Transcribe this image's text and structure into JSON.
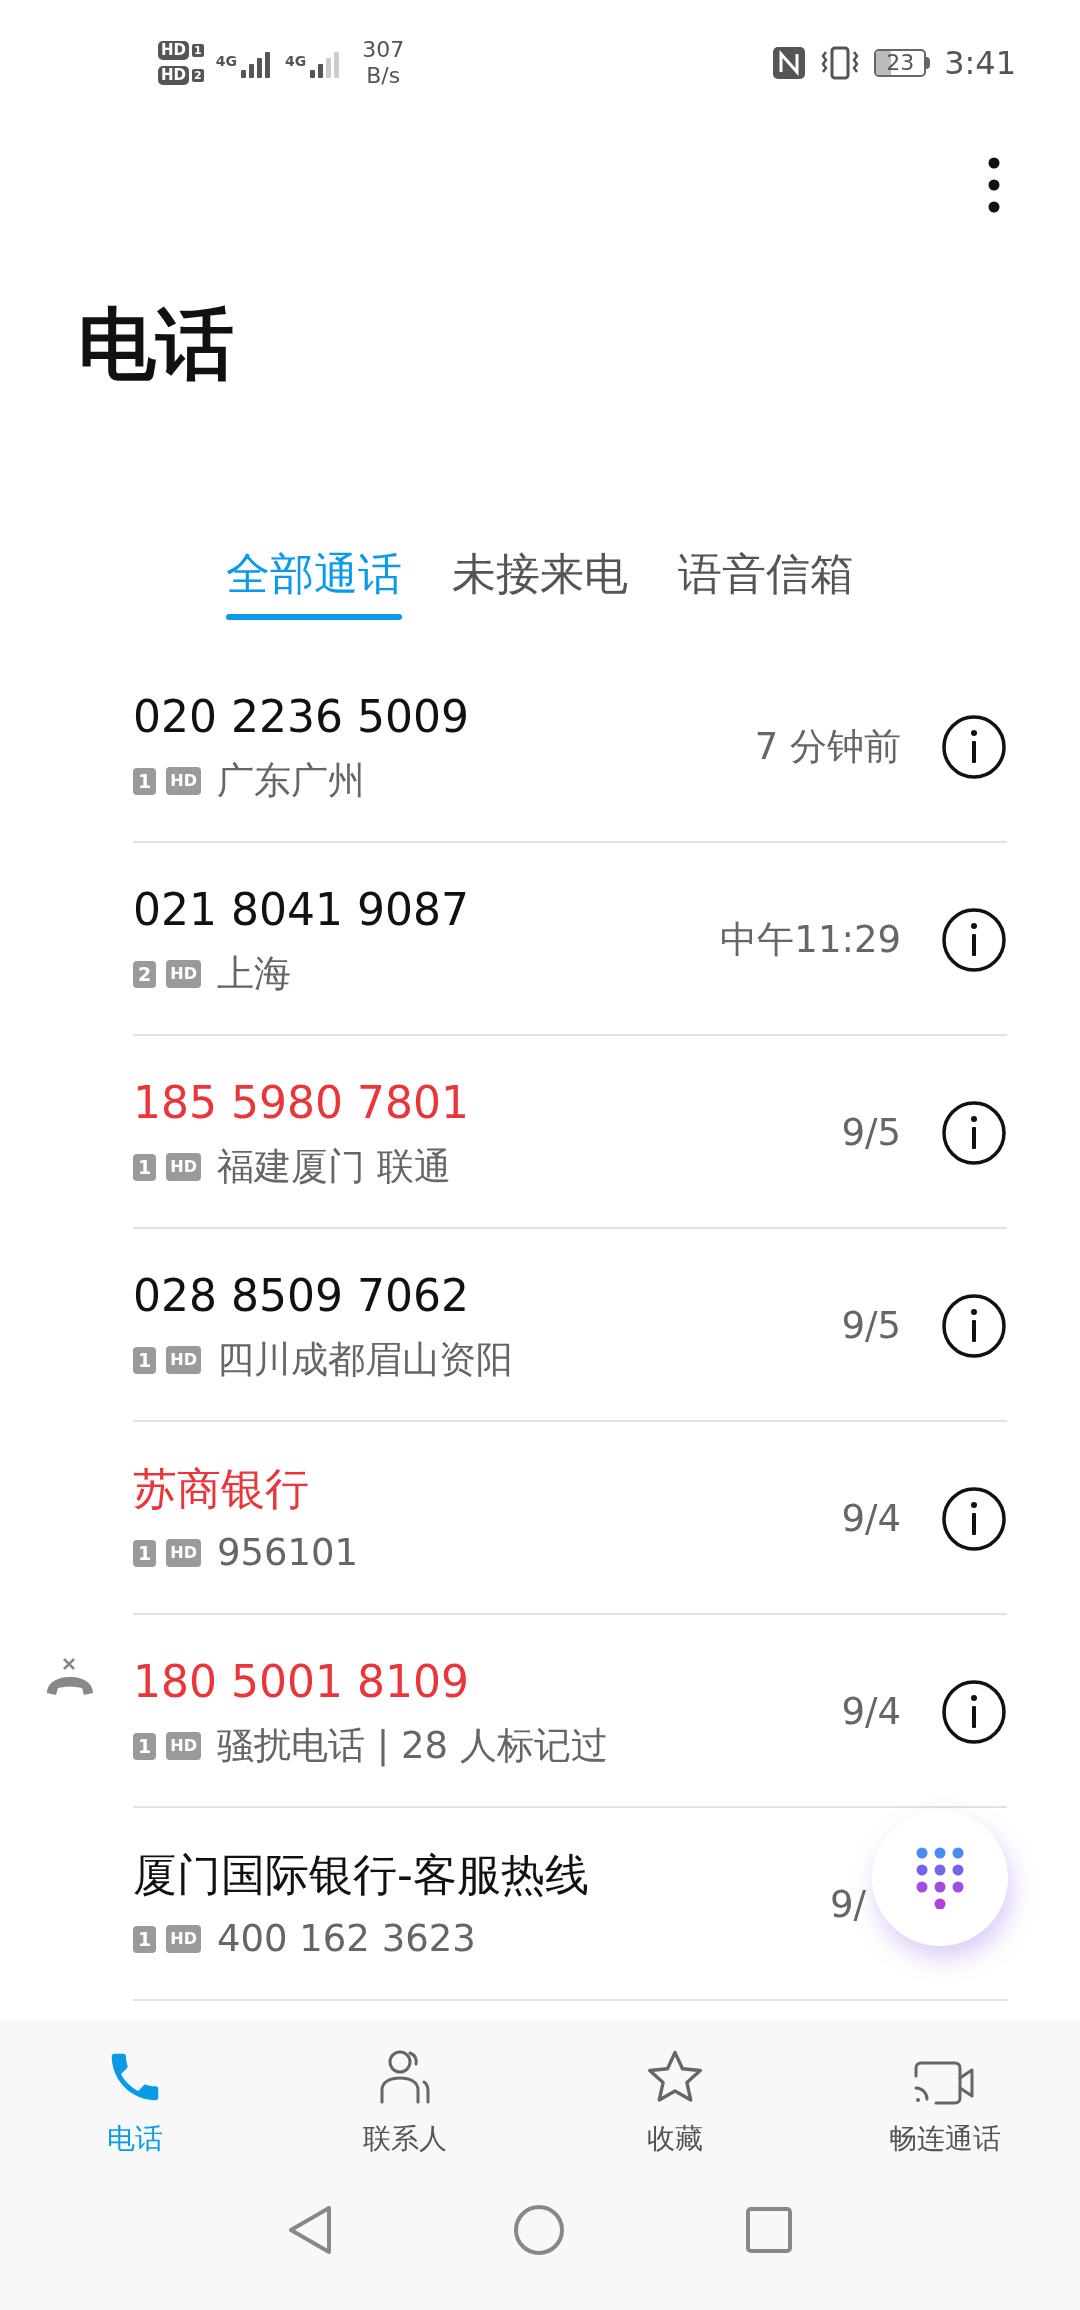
{
  "status_bar": {
    "sim_badges": [
      {
        "hd": "HD",
        "slot": "1"
      },
      {
        "hd": "HD",
        "slot": "2"
      }
    ],
    "networks": [
      {
        "type": "4G",
        "level": 1
      },
      {
        "type": "4G",
        "level": 0.5
      }
    ],
    "speed_value": "307",
    "speed_unit": "B/s",
    "battery": "23",
    "time": "3:41"
  },
  "title": "电话",
  "tabs": [
    {
      "label": "全部通话",
      "selected": true
    },
    {
      "label": "未接来电",
      "selected": false
    },
    {
      "label": "语音信箱",
      "selected": false
    }
  ],
  "calls": [
    {
      "name": "020 2236 5009",
      "missed": false,
      "rejected": false,
      "sim": "1",
      "hd": "HD",
      "detail": "广东广州",
      "time": "7 分钟前",
      "info_visible": true
    },
    {
      "name": "021 8041 9087",
      "missed": false,
      "rejected": false,
      "sim": "2",
      "hd": "HD",
      "detail": "上海",
      "time": "中午11:29",
      "info_visible": true
    },
    {
      "name": "185 5980 7801",
      "missed": true,
      "rejected": false,
      "sim": "1",
      "hd": "HD",
      "detail": "福建厦门 联通",
      "time": "9/5",
      "info_visible": true
    },
    {
      "name": "028 8509 7062",
      "missed": false,
      "rejected": false,
      "sim": "1",
      "hd": "HD",
      "detail": "四川成都眉山资阳",
      "time": "9/5",
      "info_visible": true
    },
    {
      "name": "苏商银行",
      "missed": true,
      "rejected": false,
      "sim": "1",
      "hd": "HD",
      "detail": "956101",
      "time": "9/4",
      "info_visible": true
    },
    {
      "name": "180 5001 8109",
      "missed": true,
      "rejected": true,
      "sim": "1",
      "hd": "HD",
      "detail": "骚扰电话 | 28 人标记过",
      "time": "9/4",
      "info_visible": true
    },
    {
      "name": "厦门国际银行-客服热线",
      "missed": false,
      "rejected": false,
      "sim": "1",
      "hd": "HD",
      "detail": "400 162 3623",
      "time": "9/",
      "info_visible": false
    }
  ],
  "bottom_nav": [
    {
      "kind": "phone",
      "label": "电话",
      "selected": true
    },
    {
      "kind": "contacts",
      "label": "联系人",
      "selected": false
    },
    {
      "kind": "star",
      "label": "收藏",
      "selected": false
    },
    {
      "kind": "video",
      "label": "畅连通话",
      "selected": false
    }
  ]
}
